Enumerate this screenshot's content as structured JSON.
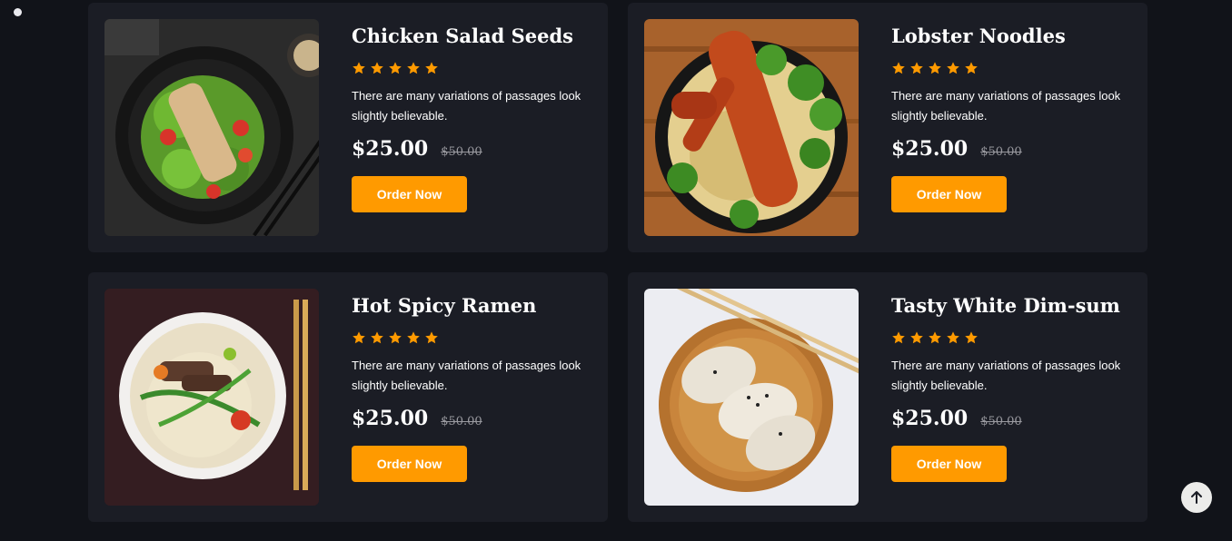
{
  "colors": {
    "background": "#111319",
    "card": "#1b1d25",
    "accent": "#ff9a00",
    "star": "#ff9a00"
  },
  "menu": {
    "items": [
      {
        "name": "Chicken Salad Seeds",
        "rating": 5,
        "description": "There are many variations of passages look slightly believable.",
        "price": "$25.00",
        "old_price": "$50.00",
        "button": "Order Now",
        "image_icon": "salad-plate-image"
      },
      {
        "name": "Lobster Noodles",
        "rating": 5,
        "description": "There are many variations of passages look slightly believable.",
        "price": "$25.00",
        "old_price": "$50.00",
        "button": "Order Now",
        "image_icon": "lobster-noodles-image"
      },
      {
        "name": "Hot Spicy Ramen",
        "rating": 5,
        "description": "There are many variations of passages look slightly believable.",
        "price": "$25.00",
        "old_price": "$50.00",
        "button": "Order Now",
        "image_icon": "ramen-bowl-image"
      },
      {
        "name": "Tasty White Dim-sum",
        "rating": 5,
        "description": "There are many variations of passages look slightly believable.",
        "price": "$25.00",
        "old_price": "$50.00",
        "button": "Order Now",
        "image_icon": "dim-sum-image"
      }
    ]
  },
  "scroll_top": {
    "icon": "arrow-up-icon"
  }
}
